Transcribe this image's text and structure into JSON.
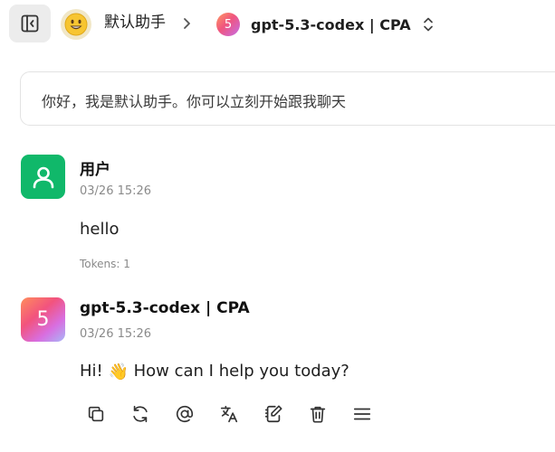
{
  "header": {
    "assistant_name": "默认助手",
    "model_name": "gpt-5.3-codex | CPA",
    "model_logo_glyph": "5"
  },
  "greeting": {
    "text": "你好，我是默认助手。你可以立刻开始跟我聊天"
  },
  "messages": [
    {
      "role": "user",
      "sender": "用户",
      "timestamp": "03/26 15:26",
      "text": "hello",
      "tokens": "Tokens: 1"
    },
    {
      "role": "assistant",
      "sender": "gpt-5.3-codex | CPA",
      "timestamp": "03/26 15:26",
      "text_before": "Hi! ",
      "emoji": "👋",
      "text_after": " How can I help you today?",
      "avatar_glyph": "5"
    }
  ],
  "icons": {
    "sidebar_toggle": "sidebar-toggle-icon",
    "assistant_avatar": "smiley-emoji-icon",
    "breadcrumb": "chevron-right-icon",
    "model_switch": "chevron-up-down-icon",
    "user_avatar": "user-icon",
    "actions": [
      "copy-icon",
      "regenerate-icon",
      "mention-icon",
      "translate-icon",
      "edit-icon",
      "delete-icon",
      "menu-icon"
    ]
  },
  "colors": {
    "user_avatar_bg": "#10b86a",
    "toggle_bg": "#ececec",
    "border": "#e3e3e3",
    "muted_text": "#8a8a8a"
  }
}
